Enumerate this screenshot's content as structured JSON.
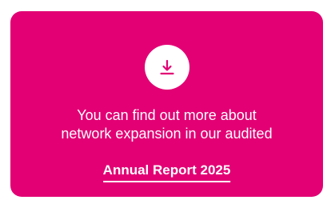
{
  "card": {
    "background_color": "#e20074",
    "text_color": "#ffffff",
    "icon": "download-icon",
    "message_line_1": "You can find out more about",
    "message_line_2": "network expansion in our audited",
    "link_label": "Annual Report 2025"
  }
}
